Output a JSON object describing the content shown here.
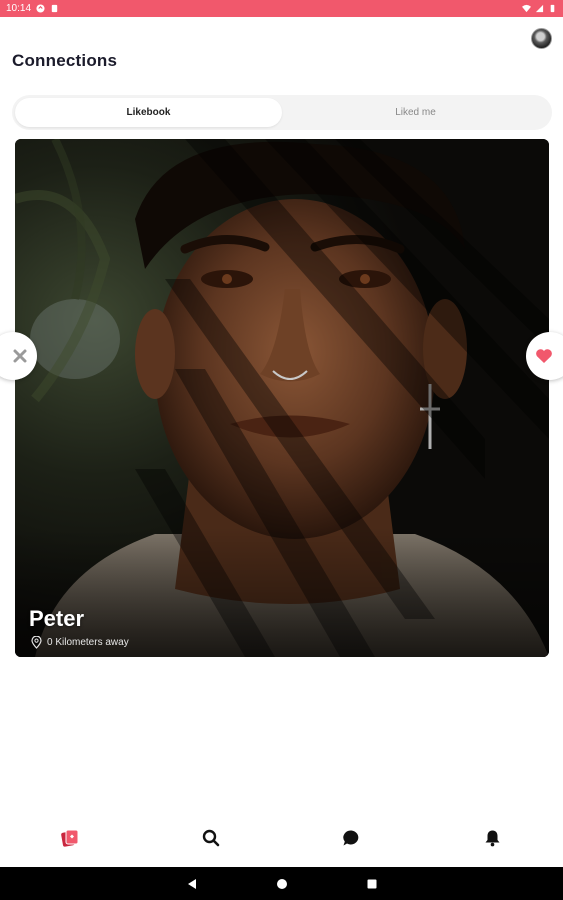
{
  "status_bar": {
    "time": "10:14"
  },
  "header": {
    "title": "Connections"
  },
  "tabs": [
    {
      "label": "Likebook",
      "active": true
    },
    {
      "label": "Liked me",
      "active": false
    }
  ],
  "profile_card": {
    "name": "Peter",
    "distance": "0 Kilometers away"
  },
  "actions": {
    "reject_icon": "close-icon",
    "like_icon": "heart-icon"
  },
  "bottom_nav": {
    "items": [
      {
        "icon": "cards-icon",
        "active": true
      },
      {
        "icon": "search-icon",
        "active": false
      },
      {
        "icon": "chat-icon",
        "active": false
      },
      {
        "icon": "bell-icon",
        "active": false
      }
    ]
  },
  "colors": {
    "accent": "#f1586c",
    "status_bar": "#f1586c",
    "text_dark": "#1b1b2b"
  }
}
